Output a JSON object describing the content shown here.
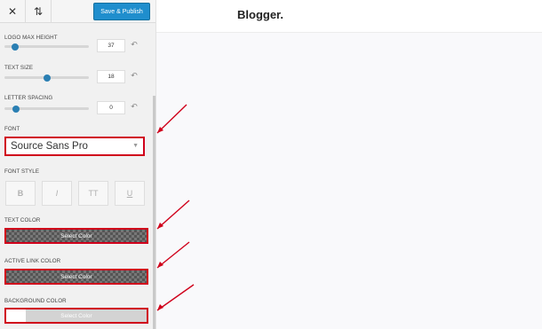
{
  "toolbar": {
    "close_icon": "close-icon",
    "sort_icon": "sort-arrows-icon",
    "publish_label": "Save & Publish"
  },
  "controls": {
    "logo_max_height": {
      "label": "LOGO MAX HEIGHT",
      "value": "37",
      "slider_fraction": 0.1
    },
    "text_size": {
      "label": "TEXT SIZE",
      "value": "18",
      "slider_fraction": 0.5
    },
    "letter_spacing": {
      "label": "LETTER SPACING",
      "value": "0",
      "slider_fraction": 0.1
    },
    "font": {
      "label": "FONT",
      "value": "Source Sans Pro"
    },
    "font_style": {
      "label": "FONT STYLE",
      "buttons": [
        "B",
        "I",
        "TT",
        "U"
      ]
    },
    "text_color": {
      "label": "TEXT COLOR",
      "button": "Select Color"
    },
    "active_link_color": {
      "label": "ACTIVE LINK COLOR",
      "button": "Select Color"
    },
    "background_color": {
      "label": "BACKGROUND COLOR",
      "button": "Select Color"
    }
  },
  "preview": {
    "brand": "Blogger",
    "brand_dot": "."
  },
  "colors": {
    "accent": "#1f8ecd",
    "highlight": "#d0021b",
    "slider_thumb": "#2a7fb3"
  }
}
